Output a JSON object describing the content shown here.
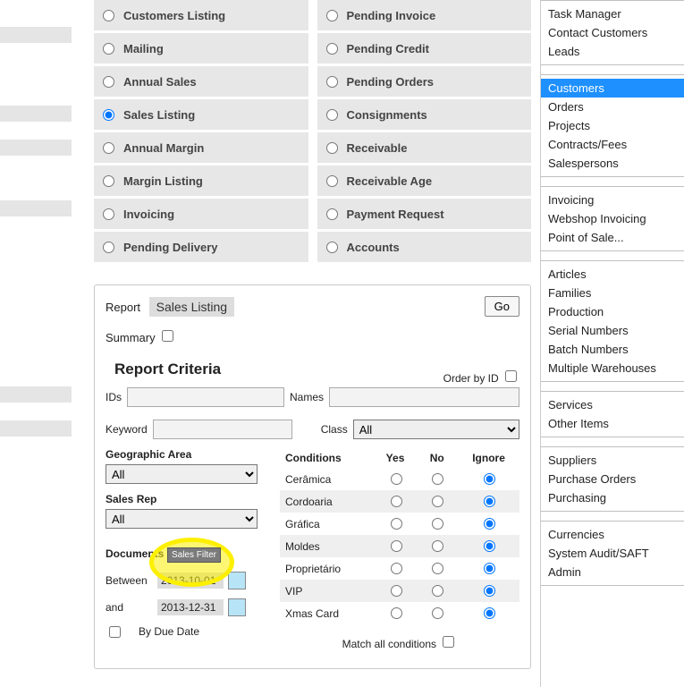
{
  "options_col1": [
    "Customers Listing",
    "Mailing",
    "Annual Sales",
    "Sales Listing",
    "Annual Margin",
    "Margin Listing",
    "Invoicing",
    "Pending Delivery"
  ],
  "options_col2": [
    "Pending Invoice",
    "Pending Credit",
    "Pending Orders",
    "Consignments",
    "Receivable",
    "Receivable Age",
    "Payment Request",
    "Accounts"
  ],
  "selected_option": "Sales Listing",
  "report": {
    "label": "Report",
    "name": "Sales Listing",
    "go": "Go",
    "summary_label": "Summary",
    "criteria_title": "Report Criteria",
    "orderby_label": "Order by ID",
    "ids_label": "IDs",
    "names_label": "Names",
    "keyword_label": "Keyword",
    "class_label": "Class",
    "class_value": "All",
    "geo_label": "Geographic Area",
    "geo_value": "All",
    "salesrep_label": "Sales Rep",
    "salesrep_value": "All",
    "documents_label": "Documents",
    "sales_filter_btn": "Sales Filter",
    "between_label": "Between",
    "between_value": "2013-10-01",
    "and_label": "and",
    "and_value": "2013-12-31",
    "byduedate_label": "By Due Date",
    "matchall_label": "Match all conditions"
  },
  "conditions": {
    "header": [
      "Conditions",
      "Yes",
      "No",
      "Ignore"
    ],
    "rows": [
      "Cerâmica",
      "Cordoaria",
      "Gráfica",
      "Moldes",
      "Proprietário",
      "VIP",
      "Xmas Card"
    ]
  },
  "sidebar": {
    "g1": [
      "Task Manager",
      "Contact Customers",
      "Leads"
    ],
    "g2": [
      "Customers",
      "Orders",
      "Projects",
      "Contracts/Fees",
      "Salespersons"
    ],
    "g3": [
      "Invoicing",
      "Webshop Invoicing",
      "Point of Sale..."
    ],
    "g4": [
      "Articles",
      "Families",
      "Production",
      "Serial Numbers",
      "Batch Numbers",
      "Multiple Warehouses"
    ],
    "g5": [
      "Services",
      "Other Items"
    ],
    "g6": [
      "Suppliers",
      "Purchase Orders",
      "Purchasing"
    ],
    "g7": [
      "Currencies",
      "System Audit/SAFT",
      "Admin"
    ],
    "selected": "Customers"
  }
}
